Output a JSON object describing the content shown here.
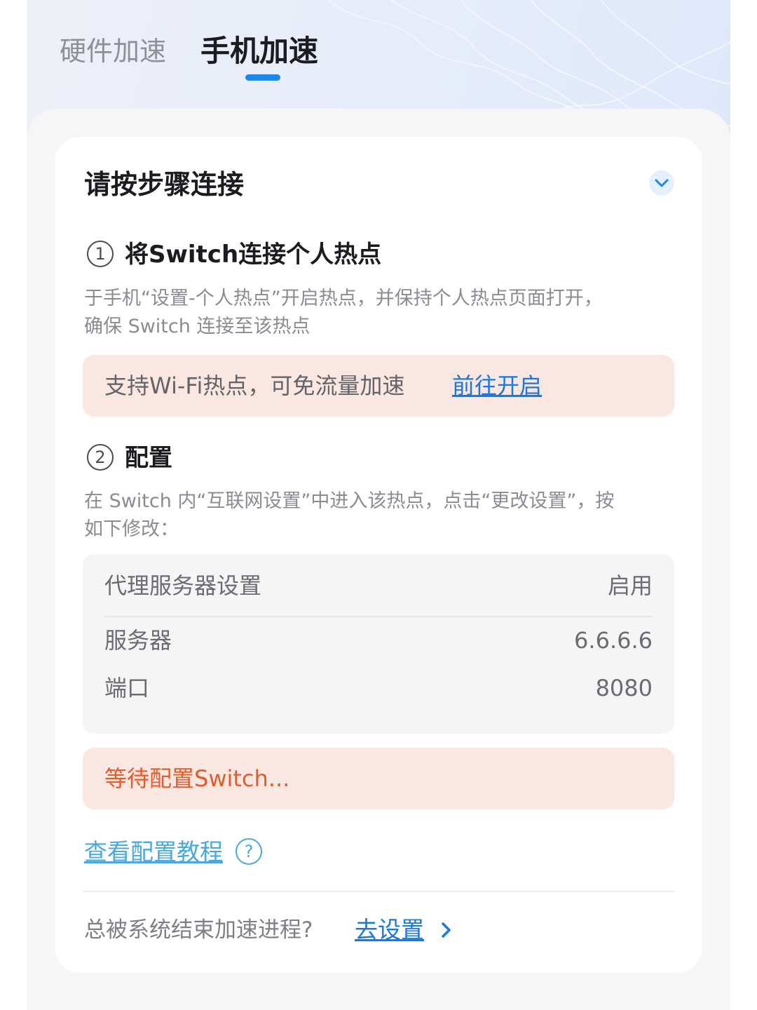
{
  "tabs": [
    {
      "label": "硬件加速",
      "active": false
    },
    {
      "label": "手机加速",
      "active": true
    }
  ],
  "card": {
    "title": "请按步骤连接",
    "collapse_icon": "chevron-down-icon"
  },
  "step1": {
    "number": "1",
    "title": "将Switch连接个人热点",
    "desc_line1": "于手机“设置-个人热点”开启热点，并保持个人热点页面打开，",
    "desc_line2": "确保 Switch 连接至该热点",
    "notice_text": "支持Wi-Fi热点，可免流量加速",
    "notice_link": "前往开启"
  },
  "step2": {
    "number": "2",
    "title": "配置",
    "desc_line1": "在 Switch 内“互联网设置”中进入该热点，点击“更改设置”，按",
    "desc_line2": "如下修改：",
    "config": {
      "proxy_label": "代理服务器设置",
      "proxy_value": "启用",
      "server_label": "服务器",
      "server_value": "6.6.6.6",
      "port_label": "端口",
      "port_value": "8080"
    },
    "waiting_text": "等待配置Switch..."
  },
  "tutorial": {
    "link": "查看配置教程",
    "icon": "help-circle-icon",
    "icon_glyph": "?"
  },
  "footer": {
    "question": "总被系统结束加速进程?",
    "link": "去设置",
    "icon": "chevron-right-icon"
  },
  "colors": {
    "accent": "#1d87f0",
    "link": "#1778e6",
    "notice_bg": "#fbe7e1",
    "waiting_text": "#e95a2a",
    "tutorial_link": "#47a9e0"
  }
}
